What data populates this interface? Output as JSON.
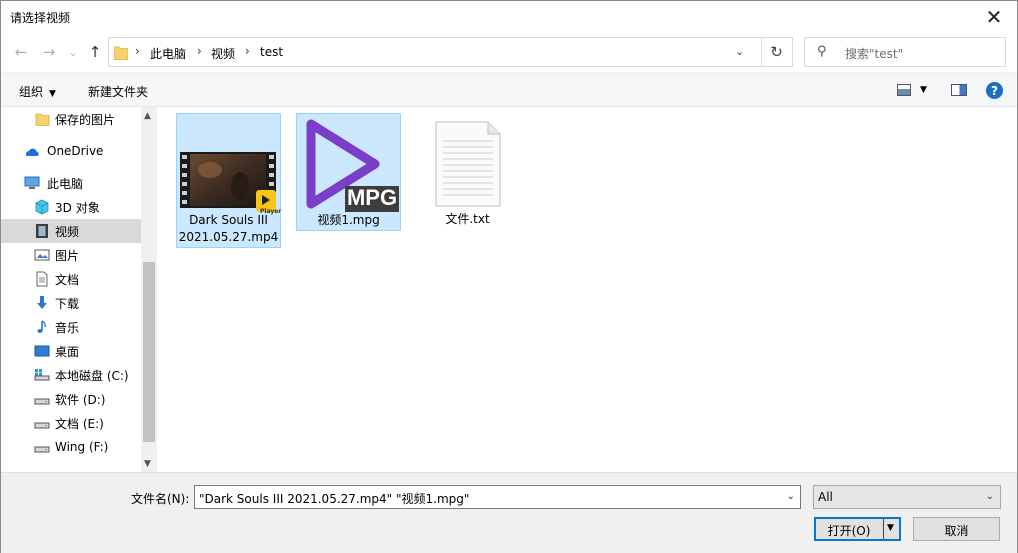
{
  "window": {
    "title": "请选择视频",
    "close_glyph": "✕"
  },
  "nav": {
    "back_glyph": "←",
    "forward_glyph": "→",
    "recent_glyph": "⌄",
    "up_glyph": "↑",
    "breadcrumb": [
      "此电脑",
      "视频",
      "test"
    ],
    "breadcrumb_sep": "›",
    "refresh_glyph": "↻",
    "search_placeholder": "搜索\"test\"",
    "search_icon": "⚲"
  },
  "toolbar": {
    "organize_label": "组织",
    "organize_caret": "▼",
    "new_folder_label": "新建文件夹",
    "view_caret": "▼",
    "help_glyph": "?"
  },
  "sidebar": {
    "items": [
      {
        "label": "保存的图片",
        "icon": "folder-icon"
      },
      {
        "label": "OneDrive",
        "icon": "onedrive-icon"
      },
      {
        "label": "此电脑",
        "icon": "this-pc-icon"
      },
      {
        "label": "3D 对象",
        "icon": "3d-objects-icon"
      },
      {
        "label": "视频",
        "icon": "videos-icon",
        "selected": true
      },
      {
        "label": "图片",
        "icon": "pictures-icon"
      },
      {
        "label": "文档",
        "icon": "documents-icon"
      },
      {
        "label": "下载",
        "icon": "downloads-icon"
      },
      {
        "label": "音乐",
        "icon": "music-icon"
      },
      {
        "label": "桌面",
        "icon": "desktop-icon"
      },
      {
        "label": "本地磁盘 (C:)",
        "icon": "system-drive-icon"
      },
      {
        "label": "软件 (D:)",
        "icon": "drive-icon"
      },
      {
        "label": "文档 (E:)",
        "icon": "drive-icon"
      },
      {
        "label": "Wing (F:)",
        "icon": "drive-icon"
      }
    ]
  },
  "files": [
    {
      "name_line1": "Dark Souls III",
      "name_line2": "2021.05.27.mp4",
      "type": "video-mp4",
      "selected": true,
      "badge": "Player"
    },
    {
      "name_line1": "视频1.mpg",
      "name_line2": "",
      "type": "video-mpg",
      "selected": true,
      "badge": "MPG"
    },
    {
      "name_line1": "文件.txt",
      "name_line2": "",
      "type": "text",
      "selected": false
    }
  ],
  "bottom": {
    "filename_label": "文件名(N):",
    "filename_value": "\"Dark Souls III 2021.05.27.mp4\" \"视频1.mpg\"",
    "filter_value": "All",
    "open_label": "打开(O)",
    "open_caret": "▼",
    "cancel_label": "取消"
  },
  "colors": {
    "accent": "#0078d7",
    "selection": "#cce8ff",
    "mpg_purple": "#7a3ec8",
    "help_blue": "#1c6ec7"
  }
}
